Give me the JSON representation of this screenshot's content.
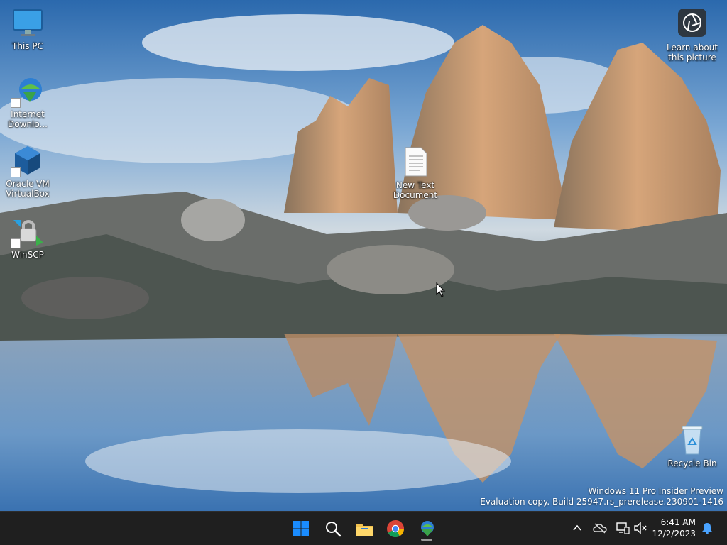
{
  "desktop": {
    "icons": [
      {
        "label": "This PC",
        "icon": "monitor-icon"
      },
      {
        "label": "Internet\nDownlo...",
        "icon": "internet-download-manager-icon"
      },
      {
        "label": "Oracle VM\nVirtualBox",
        "icon": "virtualbox-icon"
      },
      {
        "label": "WinSCP",
        "icon": "winscp-icon"
      },
      {
        "label": "New Text\nDocument",
        "icon": "text-document-icon"
      },
      {
        "label": "Learn about\nthis picture",
        "icon": "camera-icon"
      },
      {
        "label": "Recycle Bin",
        "icon": "recycle-bin-icon"
      }
    ]
  },
  "watermark": {
    "line1": "Windows 11 Pro Insider Preview",
    "line2": "Evaluation copy. Build 25947.rs_prerelease.230901-1416"
  },
  "taskbar": {
    "apps": [
      {
        "name": "start",
        "icon": "windows-logo-icon"
      },
      {
        "name": "search",
        "icon": "search-icon"
      },
      {
        "name": "file-explorer",
        "icon": "folder-icon"
      },
      {
        "name": "chrome",
        "icon": "chrome-icon"
      },
      {
        "name": "internet-download-manager",
        "icon": "idm-icon",
        "running": true
      }
    ],
    "tray": {
      "icons": [
        "chevron-up-icon",
        "onedrive-offline-icon",
        "network-icon",
        "volume-muted-icon"
      ],
      "time": "6:41 AM",
      "date": "12/2/2023",
      "notification_icon": "bell-icon"
    }
  },
  "colors": {
    "taskbar_bg": "#1f1f1f",
    "accent_blue": "#1a8cff",
    "folder_yellow": "#f2c14e"
  }
}
